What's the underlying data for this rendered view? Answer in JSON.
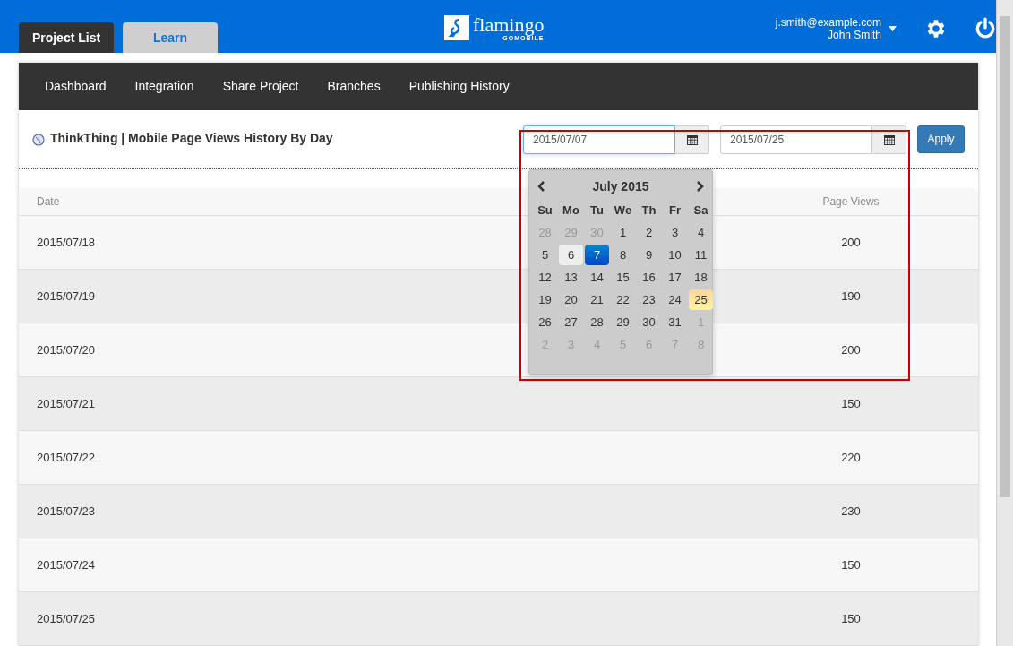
{
  "header": {
    "tabs": [
      {
        "label": "Project List",
        "selected": true
      },
      {
        "label": "Learn",
        "selected": false
      }
    ],
    "logo": {
      "name": "flamingo",
      "tagline": "GOMOBILE"
    },
    "user": {
      "email": "j.smith@example.com",
      "name": "John Smith"
    }
  },
  "nav": [
    "Dashboard",
    "Integration",
    "Share Project",
    "Branches",
    "Publishing History"
  ],
  "title": "ThinkThing | Mobile Page Views History By Day",
  "date_range": {
    "start": "2015/07/07",
    "end": "2015/07/25",
    "apply": "Apply"
  },
  "calendar": {
    "month": "July 2015",
    "weekdays": [
      "Su",
      "Mo",
      "Tu",
      "We",
      "Th",
      "Fr",
      "Sa"
    ],
    "days": [
      {
        "label": "28",
        "kind": "muted"
      },
      {
        "label": "29",
        "kind": "muted"
      },
      {
        "label": "30",
        "kind": "muted"
      },
      {
        "label": "1",
        "kind": "normal"
      },
      {
        "label": "2",
        "kind": "normal"
      },
      {
        "label": "3",
        "kind": "normal"
      },
      {
        "label": "4",
        "kind": "normal"
      },
      {
        "label": "5",
        "kind": "normal"
      },
      {
        "label": "6",
        "kind": "hover"
      },
      {
        "label": "7",
        "kind": "selected"
      },
      {
        "label": "8",
        "kind": "normal"
      },
      {
        "label": "9",
        "kind": "normal"
      },
      {
        "label": "10",
        "kind": "normal"
      },
      {
        "label": "11",
        "kind": "normal"
      },
      {
        "label": "12",
        "kind": "normal"
      },
      {
        "label": "13",
        "kind": "normal"
      },
      {
        "label": "14",
        "kind": "normal"
      },
      {
        "label": "15",
        "kind": "normal"
      },
      {
        "label": "16",
        "kind": "normal"
      },
      {
        "label": "17",
        "kind": "normal"
      },
      {
        "label": "18",
        "kind": "normal"
      },
      {
        "label": "19",
        "kind": "normal"
      },
      {
        "label": "20",
        "kind": "normal"
      },
      {
        "label": "21",
        "kind": "normal"
      },
      {
        "label": "22",
        "kind": "normal"
      },
      {
        "label": "23",
        "kind": "normal"
      },
      {
        "label": "24",
        "kind": "normal"
      },
      {
        "label": "25",
        "kind": "range-end"
      },
      {
        "label": "26",
        "kind": "normal"
      },
      {
        "label": "27",
        "kind": "normal"
      },
      {
        "label": "28",
        "kind": "normal"
      },
      {
        "label": "29",
        "kind": "normal"
      },
      {
        "label": "30",
        "kind": "normal"
      },
      {
        "label": "31",
        "kind": "normal"
      },
      {
        "label": "1",
        "kind": "muted"
      },
      {
        "label": "2",
        "kind": "muted"
      },
      {
        "label": "3",
        "kind": "muted"
      },
      {
        "label": "4",
        "kind": "muted"
      },
      {
        "label": "5",
        "kind": "muted"
      },
      {
        "label": "6",
        "kind": "muted"
      },
      {
        "label": "7",
        "kind": "muted"
      },
      {
        "label": "8",
        "kind": "muted"
      }
    ]
  },
  "table": {
    "columns": [
      "Date",
      "Page Views"
    ],
    "rows": [
      {
        "date": "2015/07/18",
        "views": "200"
      },
      {
        "date": "2015/07/19",
        "views": "190"
      },
      {
        "date": "2015/07/20",
        "views": "200"
      },
      {
        "date": "2015/07/21",
        "views": "150"
      },
      {
        "date": "2015/07/22",
        "views": "220"
      },
      {
        "date": "2015/07/23",
        "views": "230"
      },
      {
        "date": "2015/07/24",
        "views": "150"
      },
      {
        "date": "2015/07/25",
        "views": "150"
      }
    ]
  }
}
